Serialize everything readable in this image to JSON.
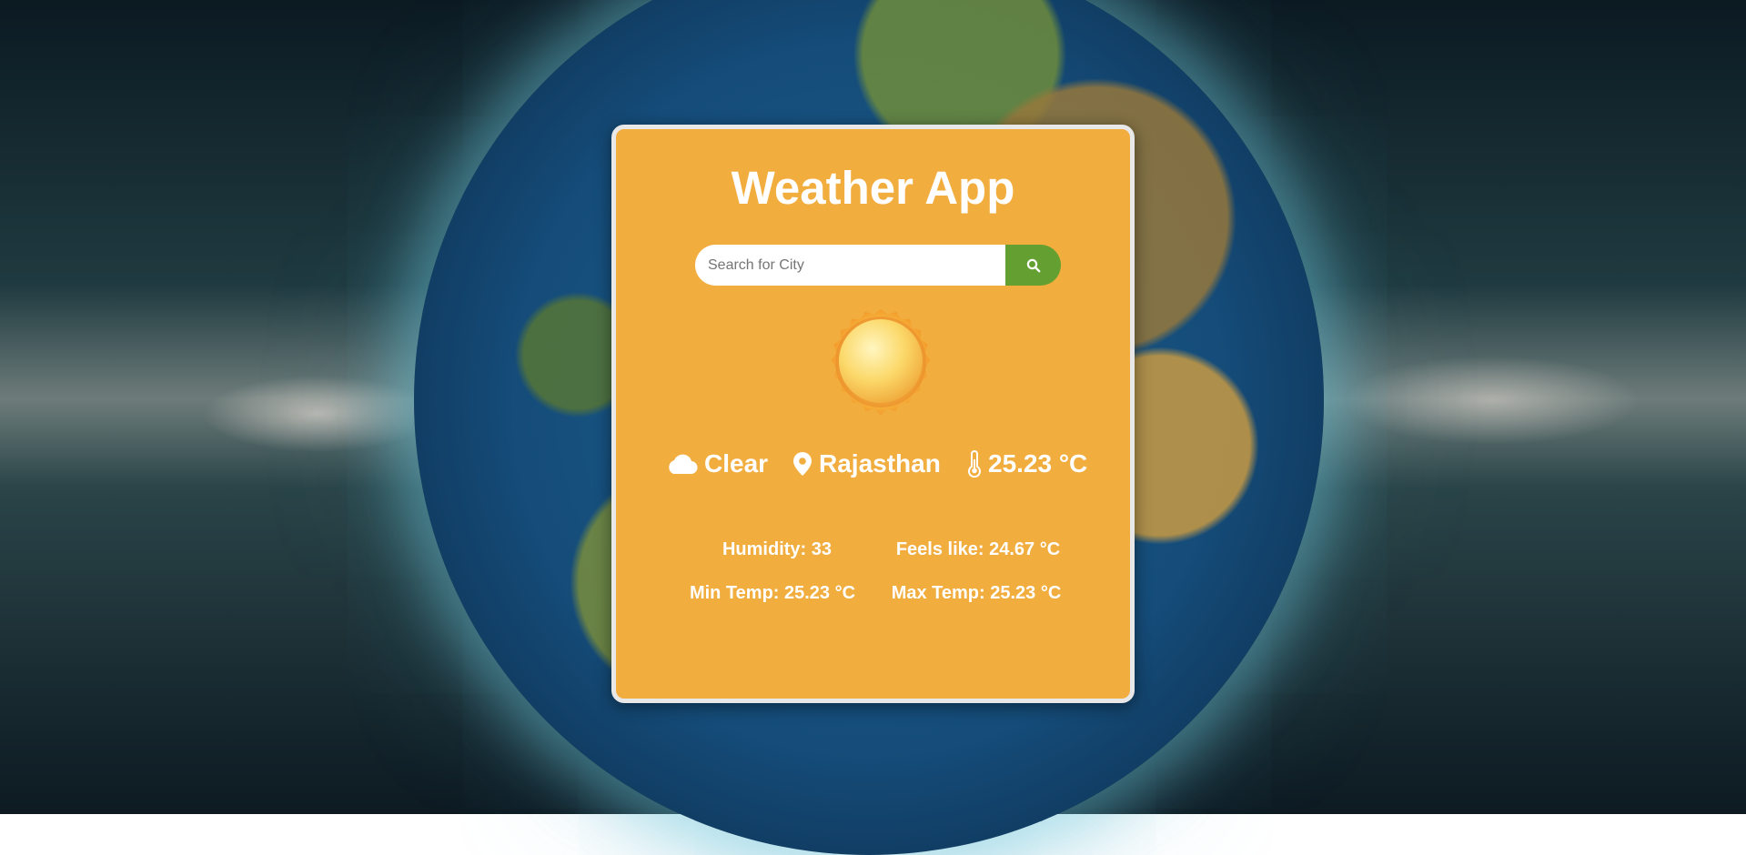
{
  "app": {
    "title": "Weather App"
  },
  "search": {
    "placeholder": "Search for City",
    "value": ""
  },
  "icons": {
    "search_button": "magnifier-icon",
    "weather_image": "sun-icon",
    "condition": "cloud-icon",
    "location": "map-pin-icon",
    "temperature": "thermometer-icon"
  },
  "weather": {
    "condition": "Clear",
    "location": "Rajasthan",
    "temperature": "25.23 °C"
  },
  "details": {
    "humidity": "Humidity: 33",
    "feels_like": "Feels like: 24.67 °C",
    "min_temp": "Min Temp: 25.23 °C",
    "max_temp": "Max Temp: 25.23 °C"
  },
  "colors": {
    "card_background": "#f2ad3f",
    "card_border": "#e8e8e8",
    "search_button": "#64a031",
    "text": "#ffffff"
  }
}
